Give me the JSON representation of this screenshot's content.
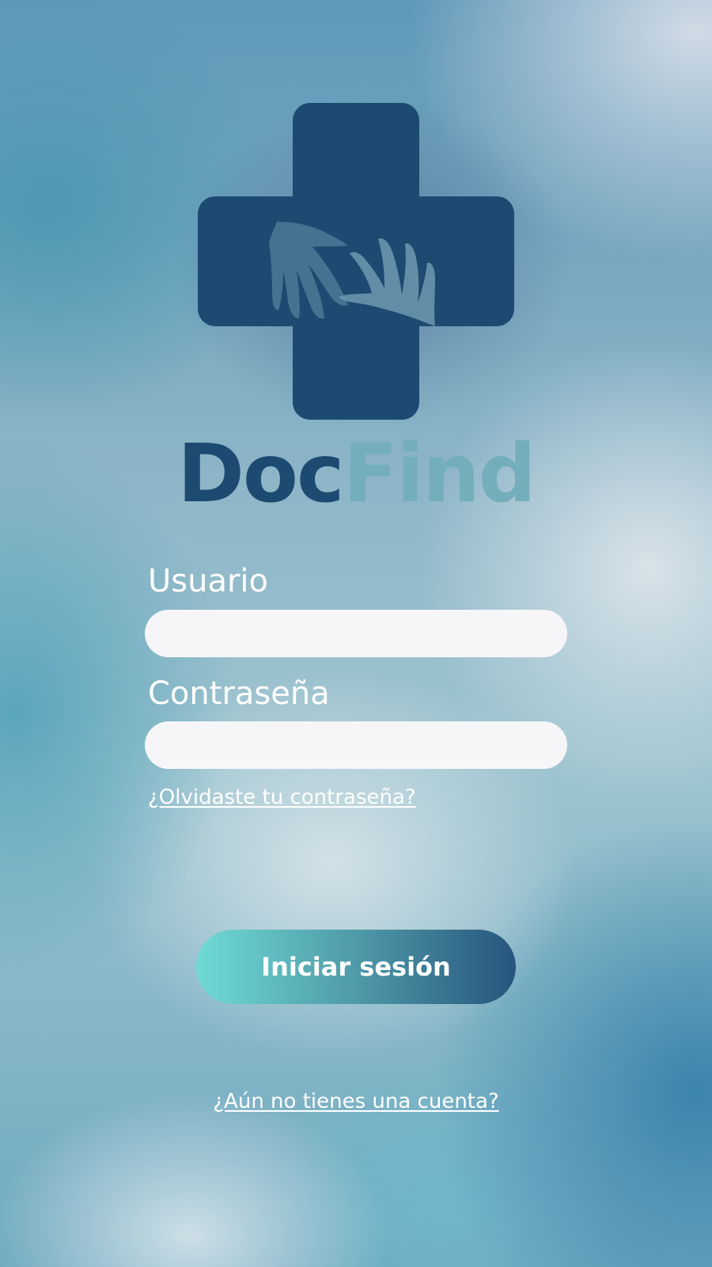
{
  "brand": {
    "part1": "Doc",
    "part2": "Find",
    "primary_color": "#1d4a70",
    "secondary_color": "#74aebb",
    "logo_icon": "medical-cross-hands-icon"
  },
  "form": {
    "username_label": "Usuario",
    "username_value": "",
    "password_label": "Contraseña",
    "password_value": "",
    "forgot_link": "¿Olvidaste tu contraseña?",
    "login_button": "Iniciar sesión",
    "register_link": "¿Aún no tienes una cuenta?"
  }
}
